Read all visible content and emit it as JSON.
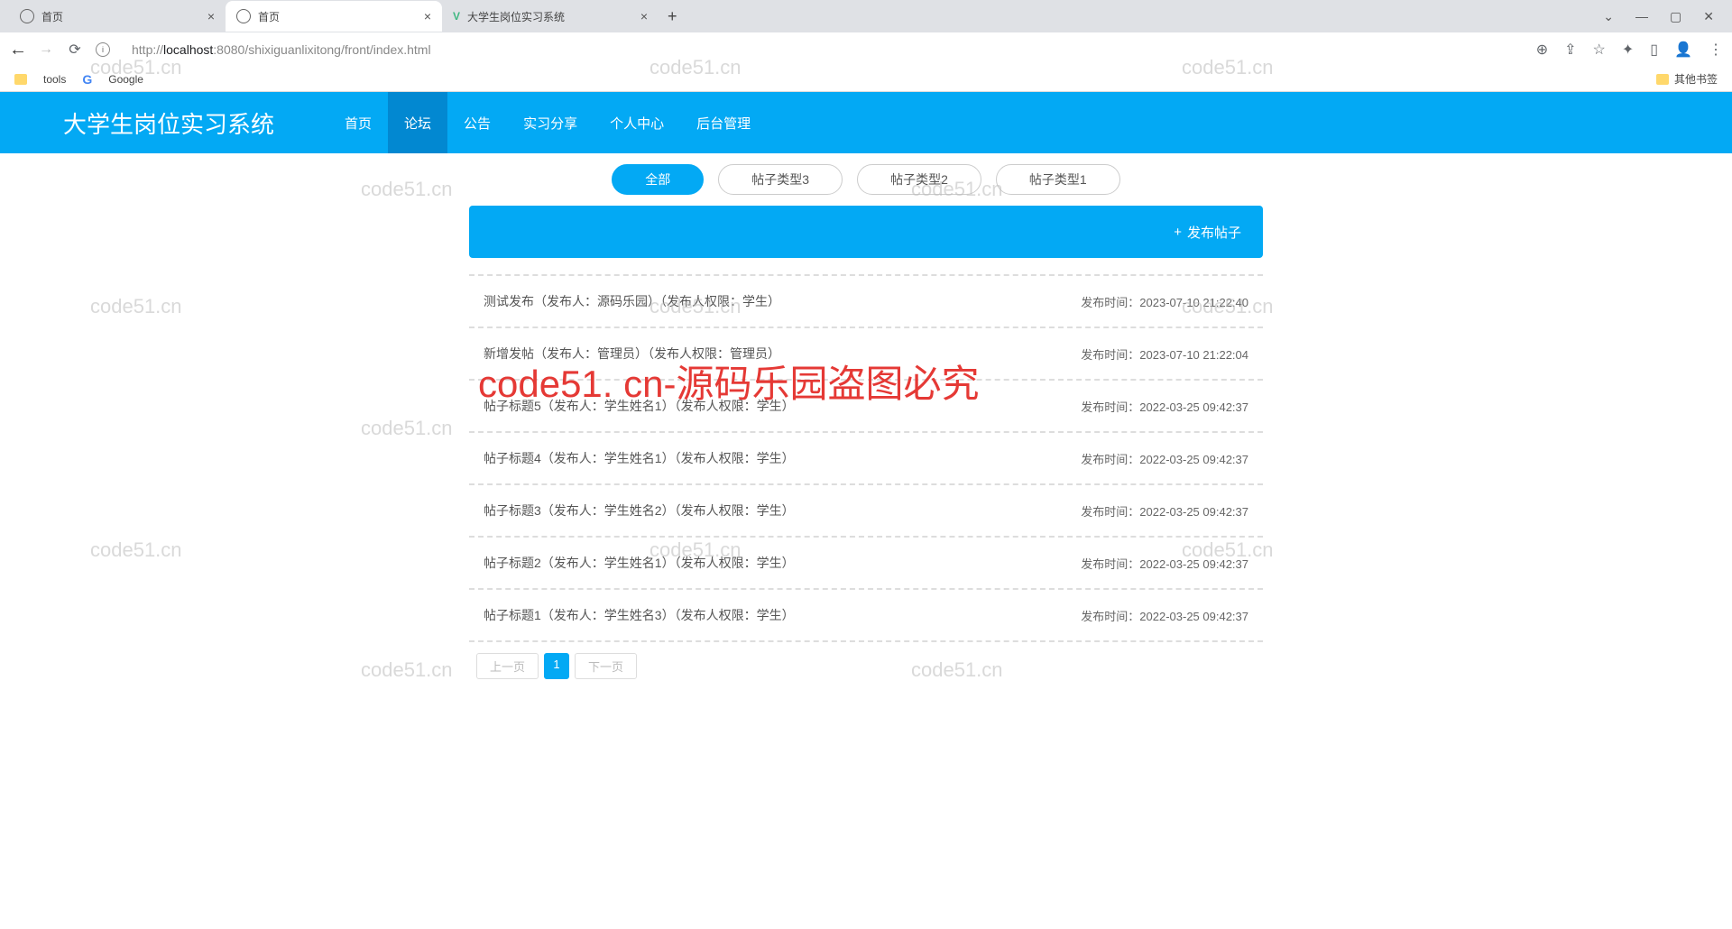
{
  "chrome": {
    "tabs": [
      {
        "title": "首页",
        "active": false
      },
      {
        "title": "首页",
        "active": true
      },
      {
        "title": "大学生岗位实习系统",
        "active": false
      }
    ],
    "url_full": "http://localhost:8080/shixiguanlixitong/front/index.html",
    "url_host": "localhost",
    "url_port": ":8080",
    "url_path": "/shixiguanlixitong/front/index.html",
    "bookmarks": {
      "b1": "tools",
      "b2": "Google",
      "other": "其他书签"
    }
  },
  "nav": {
    "brand": "大学生岗位实习系统",
    "links": [
      "首页",
      "论坛",
      "公告",
      "实习分享",
      "个人中心",
      "后台管理"
    ],
    "active": 1
  },
  "filters": {
    "tabs": [
      "全部",
      "帖子类型3",
      "帖子类型2",
      "帖子类型1"
    ],
    "active": 0
  },
  "action": {
    "new_label": "发布帖子"
  },
  "posts": [
    {
      "title": "测试发布（发布人：源码乐园）（发布人权限：学生）",
      "time_label": "发布时间：",
      "time": "2023-07-10 21:22:40"
    },
    {
      "title": "新增发帖（发布人：管理员）（发布人权限：管理员）",
      "time_label": "发布时间：",
      "time": "2023-07-10 21:22:04"
    },
    {
      "title": "帖子标题5（发布人：学生姓名1）（发布人权限：学生）",
      "time_label": "发布时间：",
      "time": "2022-03-25 09:42:37"
    },
    {
      "title": "帖子标题4（发布人：学生姓名1）（发布人权限：学生）",
      "time_label": "发布时间：",
      "time": "2022-03-25 09:42:37"
    },
    {
      "title": "帖子标题3（发布人：学生姓名2）（发布人权限：学生）",
      "time_label": "发布时间：",
      "time": "2022-03-25 09:42:37"
    },
    {
      "title": "帖子标题2（发布人：学生姓名1）（发布人权限：学生）",
      "time_label": "发布时间：",
      "time": "2022-03-25 09:42:37"
    },
    {
      "title": "帖子标题1（发布人：学生姓名3）（发布人权限：学生）",
      "time_label": "发布时间：",
      "time": "2022-03-25 09:42:37"
    }
  ],
  "pager": {
    "prev": "上一页",
    "page": "1",
    "next": "下一页"
  },
  "watermark": {
    "text": "code51.cn",
    "red": "code51. cn-源码乐园盗图必究"
  }
}
